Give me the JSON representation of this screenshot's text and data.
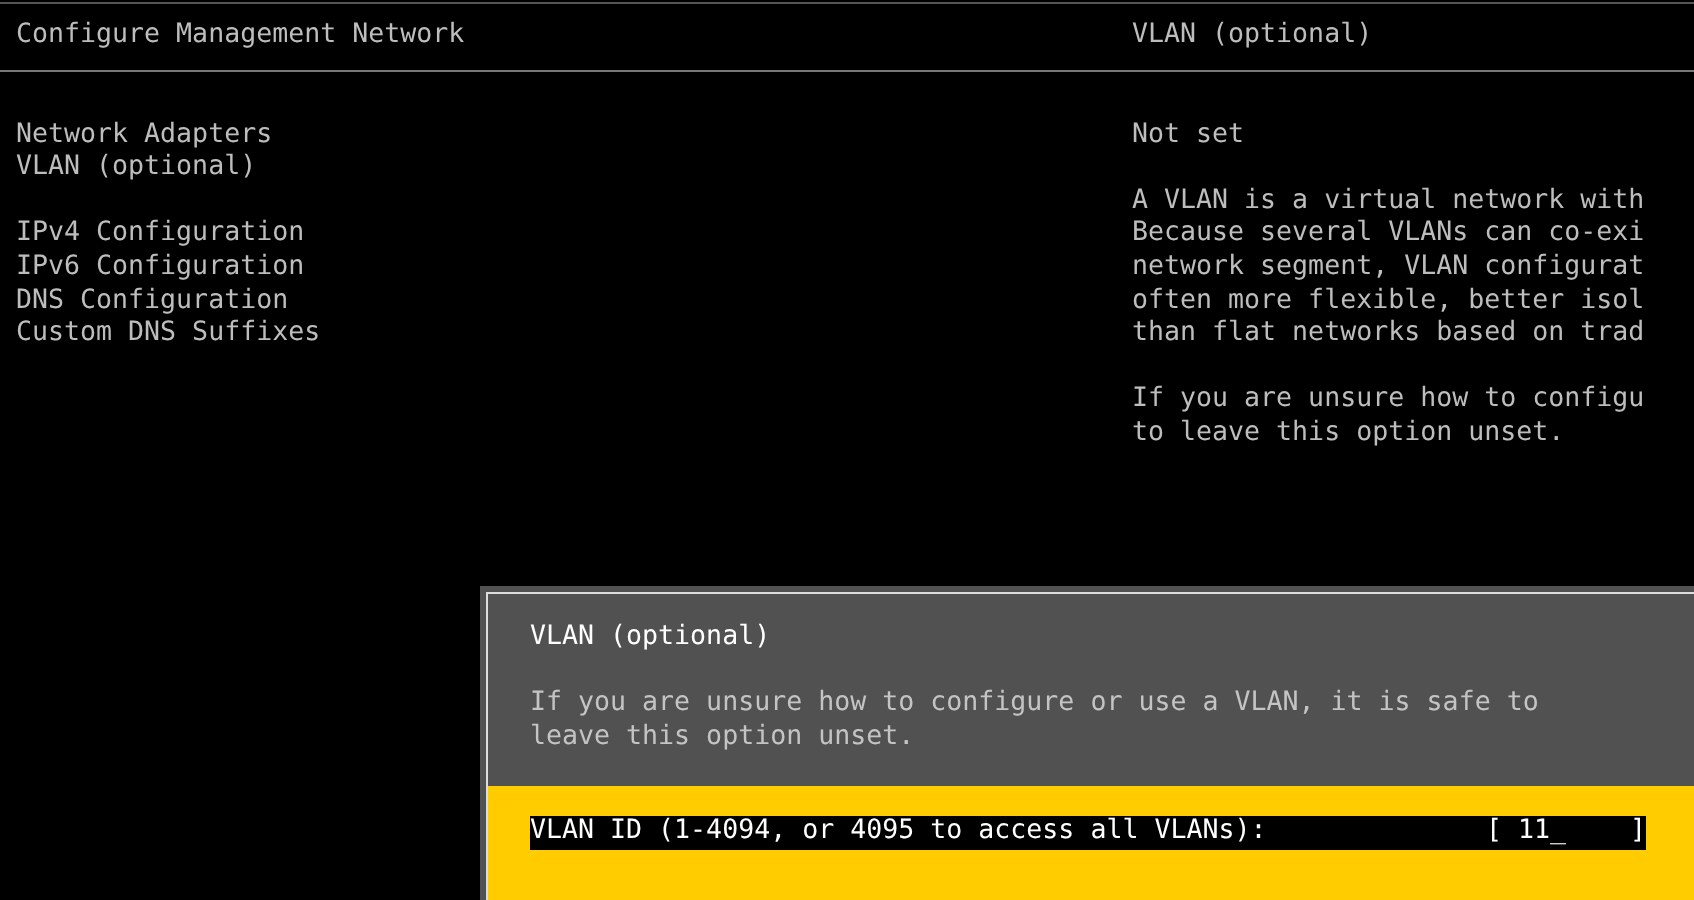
{
  "header": {
    "title": "Configure Management Network",
    "detail_title": "VLAN (optional)"
  },
  "menu_groups": [
    [
      "Network Adapters",
      "VLAN (optional)"
    ],
    [
      "IPv4 Configuration",
      "IPv6 Configuration",
      "DNS Configuration",
      "Custom DNS Suffixes"
    ]
  ],
  "detail": {
    "value": "Not set",
    "paragraphs": [
      [
        "A VLAN is a virtual network with",
        "Because several VLANs can co-exi",
        "network segment, VLAN configurat",
        "often more flexible, better isol",
        "than flat networks based on trad"
      ],
      [
        "If you are unsure how to configu",
        "to leave this option unset."
      ]
    ]
  },
  "dialog": {
    "title": "VLAN (optional)",
    "description": [
      "If you are unsure how to configure or use a VLAN, it is safe to",
      "leave this option unset."
    ],
    "field": {
      "label": "VLAN ID (1-4094, or 4095 to access all VLANs):",
      "value": "[ 11_    ]"
    }
  }
}
